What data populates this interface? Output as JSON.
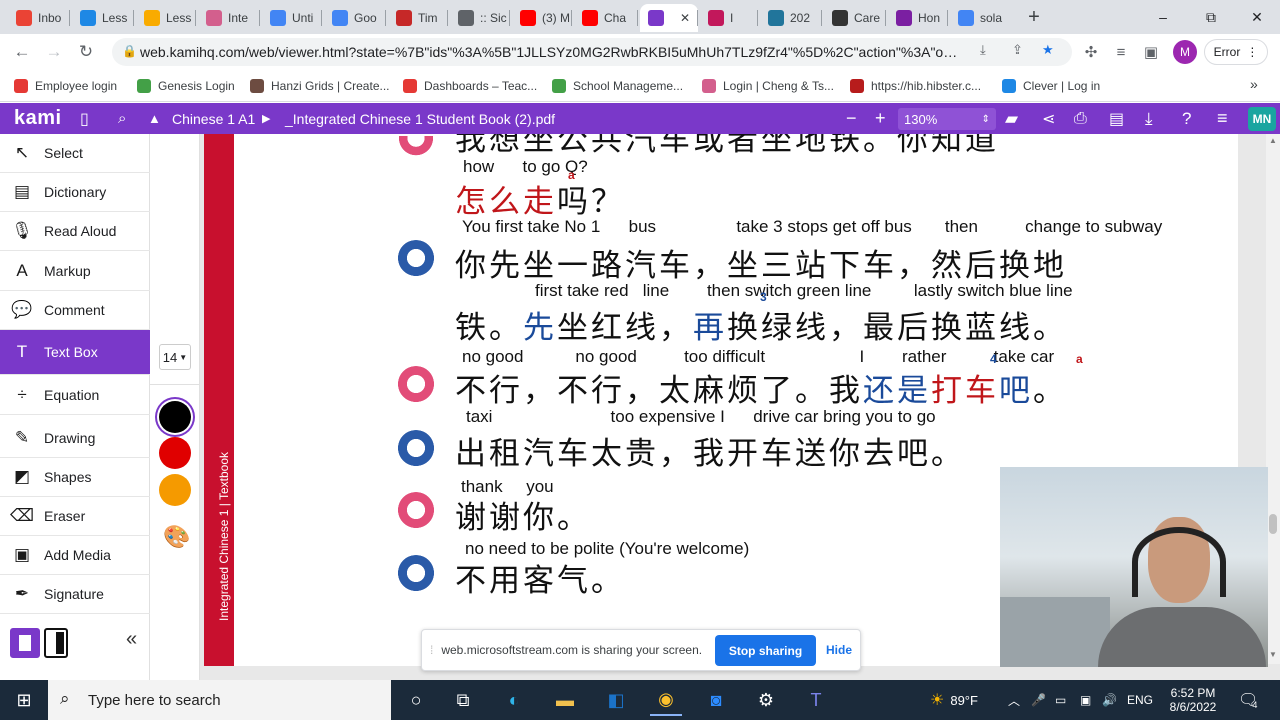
{
  "browser": {
    "tabs": [
      {
        "label": "Inbo",
        "icon": "gmail-icon",
        "color": "#ea4335"
      },
      {
        "label": "Less",
        "icon": "classroom-icon",
        "color": "#1e88e5"
      },
      {
        "label": "Less",
        "icon": "classroom-icon",
        "color": "#f9ab00"
      },
      {
        "label": "Inte",
        "icon": "web-icon",
        "color": "#d35f8d"
      },
      {
        "label": "Unti",
        "icon": "docs-icon",
        "color": "#4285f4"
      },
      {
        "label": "Goo",
        "icon": "translate-icon",
        "color": "#4285f4"
      },
      {
        "label": "Tim",
        "icon": "web-icon",
        "color": "#c62828"
      },
      {
        "label": ":: Sic",
        "icon": "globe-icon",
        "color": "#5f6368"
      },
      {
        "label": "(3) M",
        "icon": "youtube-icon",
        "color": "#ff0000"
      },
      {
        "label": "Cha",
        "icon": "youtube-icon",
        "color": "#ff0000"
      },
      {
        "label": "",
        "icon": "kami-icon",
        "color": "#7a38c9"
      },
      {
        "label": "I",
        "icon": "play-icon",
        "color": "#c2185b"
      },
      {
        "label": "202",
        "icon": "wordpress-icon",
        "color": "#21759b"
      },
      {
        "label": "Care",
        "icon": "web-icon",
        "color": "#333333"
      },
      {
        "label": "Hon",
        "icon": "web-icon",
        "color": "#7b1fa2"
      },
      {
        "label": "sola",
        "icon": "google-icon",
        "color": "#4285f4"
      }
    ],
    "new_tab": "+",
    "window_controls": {
      "minimize": "–",
      "restore": "⧉",
      "close": "✕"
    },
    "url": "web.kamihq.com/web/viewer.html?state=%7B\"ids\"%3A%5B\"1JLLSYz0MG2RwbRKBI5uMhUh7TLz9fZr4\"%5D%2C\"action\"%3A\"open\"...",
    "profile_initial": "M",
    "error_label": "Error",
    "bookmarks": [
      {
        "label": "Employee login",
        "color": "#e53935"
      },
      {
        "label": "Genesis Login",
        "color": "#43a047"
      },
      {
        "label": "Hanzi Grids | Create...",
        "color": "#6d4c41"
      },
      {
        "label": "Dashboards – Teac...",
        "color": "#e53935"
      },
      {
        "label": "School Manageme...",
        "color": "#43a047"
      },
      {
        "label": "Login | Cheng & Ts...",
        "color": "#d35f8d"
      },
      {
        "label": "https://hib.hibster.c...",
        "color": "#b71c1c"
      },
      {
        "label": "Clever | Log in",
        "color": "#1e88e5"
      }
    ],
    "more_bookmarks": "»"
  },
  "kami": {
    "logo": "kami",
    "breadcrumb": [
      "Chinese 1 A1",
      "_Integrated Chinese 1 Student Book (2).pdf"
    ],
    "zoom": "130%",
    "user_initials": "MN",
    "tools": [
      {
        "label": "Select",
        "icon": "cursor-icon",
        "glyph": "↖"
      },
      {
        "label": "Dictionary",
        "icon": "book-icon",
        "glyph": "▤"
      },
      {
        "label": "Read Aloud",
        "icon": "microphone-icon",
        "glyph": "🎙"
      },
      {
        "label": "Markup",
        "icon": "markup-icon",
        "glyph": "A"
      },
      {
        "label": "Comment",
        "icon": "comment-icon",
        "glyph": "💬"
      },
      {
        "label": "Text Box",
        "icon": "text-icon",
        "glyph": "T"
      },
      {
        "label": "Equation",
        "icon": "divide-icon",
        "glyph": "÷"
      },
      {
        "label": "Drawing",
        "icon": "brush-icon",
        "glyph": "✎"
      },
      {
        "label": "Shapes",
        "icon": "shapes-icon",
        "glyph": "◩"
      },
      {
        "label": "Eraser",
        "icon": "eraser-icon",
        "glyph": "⌫"
      },
      {
        "label": "Add Media",
        "icon": "media-icon",
        "glyph": "▣"
      },
      {
        "label": "Signature",
        "icon": "pen-icon",
        "glyph": "✒"
      }
    ],
    "font_size": "14",
    "colors": [
      "#000000",
      "#e00000",
      "#f59a00"
    ],
    "collapse": "«"
  },
  "document": {
    "side_label": "Integrated Chinese 1 | Textbook",
    "top_line": "我想坐公共汽车或者坐地铁。你知道",
    "lines": [
      {
        "gloss": "how      to go Q?",
        "text_parts": [
          {
            "t": "怎么走",
            "c": "r"
          },
          {
            "t": "吗？",
            "c": ""
          }
        ]
      },
      {
        "gloss": "You first take No 1      bus                 take 3 stops get off bus       then          change to subway",
        "text_parts": [
          {
            "t": "你先坐一路汽车，坐三站下车，然后换地",
            "c": ""
          }
        ]
      },
      {
        "gloss": "first take red   line        then switch green line         lastly switch blue line",
        "text_parts": [
          {
            "t": "铁。",
            "c": ""
          },
          {
            "t": "先",
            "c": "b"
          },
          {
            "t": "坐红线，",
            "c": ""
          },
          {
            "t": "再",
            "c": "b"
          },
          {
            "t": "换绿线，最后换蓝线。",
            "c": ""
          }
        ]
      },
      {
        "gloss": "no good           no good          too difficult                    I        rather          take car",
        "text_parts": [
          {
            "t": "不行，不行，太麻烦了。我",
            "c": ""
          },
          {
            "t": "还是",
            "c": "b"
          },
          {
            "t": "打车",
            "c": "r"
          },
          {
            "t": "吧",
            "c": "b"
          },
          {
            "t": "。",
            "c": ""
          }
        ]
      },
      {
        "gloss": "taxi                         too expensive I      drive car bring you to go",
        "text_parts": [
          {
            "t": "出租汽车太贵，我开车送你去吧。",
            "c": ""
          }
        ]
      },
      {
        "gloss": "thank     you",
        "text_parts": [
          {
            "t": "谢谢你。",
            "c": ""
          }
        ]
      },
      {
        "gloss": "no need to be polite (You're welcome)",
        "text_parts": [
          {
            "t": "不用客气。",
            "c": ""
          }
        ]
      }
    ],
    "markers": [
      "a",
      "3",
      "4",
      "a"
    ]
  },
  "share_banner": {
    "message": "web.microsoftstream.com is sharing your screen.",
    "stop_label": "Stop sharing",
    "hide_label": "Hide"
  },
  "taskbar": {
    "search_placeholder": "Type here to search",
    "weather": "89°F",
    "lang": "ENG",
    "time": "6:52 PM",
    "date": "8/6/2022",
    "notifications": "4"
  }
}
